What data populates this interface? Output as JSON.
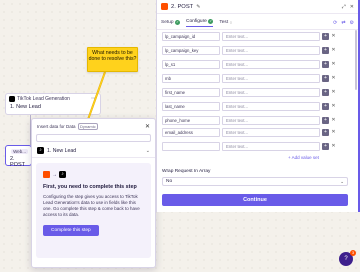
{
  "note": {
    "text": "What needs to be done to resolve this?"
  },
  "node1": {
    "app": "TikTok Lead Generation",
    "title": "1. New Lead",
    "menu": "⋯"
  },
  "node2": {
    "step": "2.",
    "tag": "Web...",
    "title": "2. POST"
  },
  "popover": {
    "title": "Insert data for Data",
    "tag": "Dynamic",
    "section": "1. New Lead",
    "heading": "First, you need to complete this step",
    "body": "Configuring the step gives you access to TikTok Lead Generation's data to use in fields like this one. Go complete this step & come back to have access to its data.",
    "button": "Complete this step"
  },
  "panel": {
    "title": "2. POST",
    "tabs": [
      {
        "label": "Setup"
      },
      {
        "label": "Configure"
      },
      {
        "label": "Test"
      }
    ],
    "fields": [
      {
        "key": "lp_campaign_id",
        "placeholder": "Enter text..."
      },
      {
        "key": "lp_campaign_key",
        "placeholder": "Enter text..."
      },
      {
        "key": "lp_s1",
        "placeholder": "Enter text..."
      },
      {
        "key": "mb",
        "placeholder": "Enter text..."
      },
      {
        "key": "first_name",
        "placeholder": "Enter text..."
      },
      {
        "key": "last_name",
        "placeholder": "Enter text..."
      },
      {
        "key": "phone_home",
        "placeholder": "Enter text..."
      },
      {
        "key": "email_address",
        "placeholder": "Enter text..."
      },
      {
        "key": "",
        "placeholder": "Enter text..."
      }
    ],
    "add_value_set": "+ Add value set",
    "wrap_label": "Wrap Request In Array",
    "wrap_value": "No",
    "continue": "Continue"
  },
  "help": {
    "badge": "3"
  },
  "colors": {
    "accent": "#695be8",
    "brand": "#ff4f00",
    "note": "#ffd21c"
  }
}
